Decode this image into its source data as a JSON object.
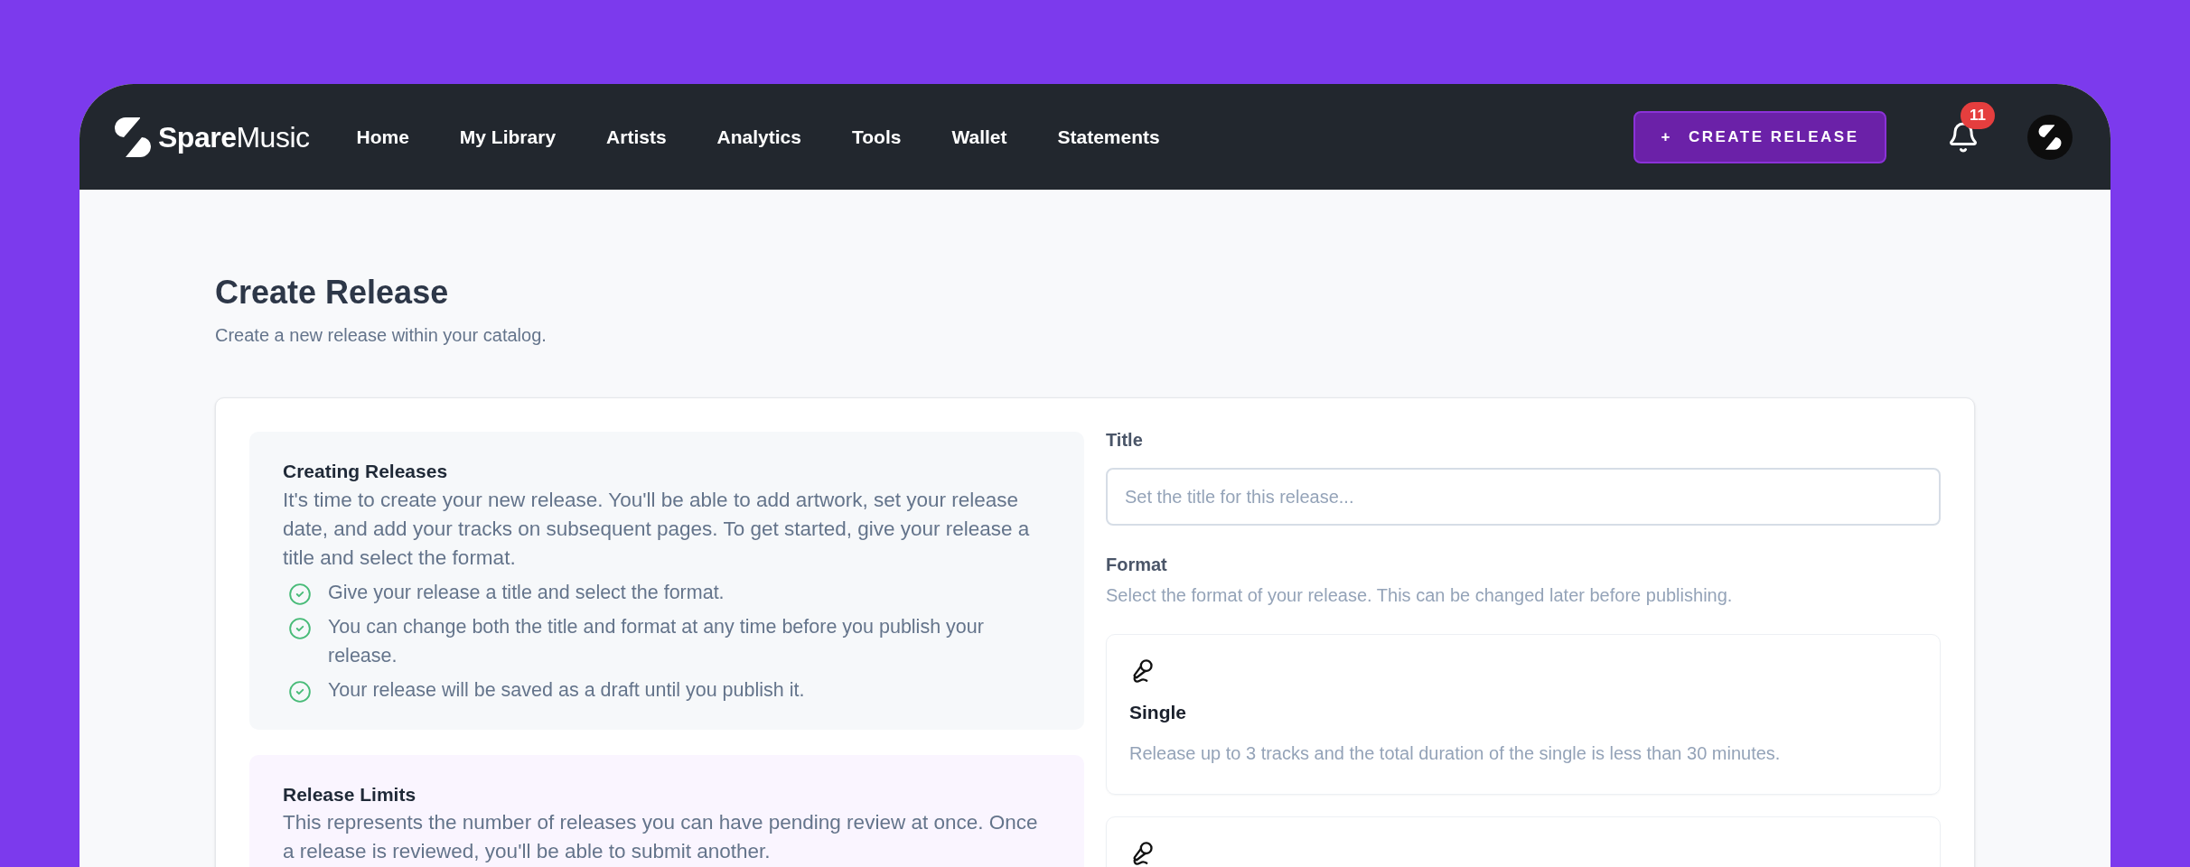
{
  "header": {
    "logo": "**Spare**Music",
    "nav": [
      {
        "label": "Home"
      },
      {
        "label": "My Library"
      },
      {
        "label": "Artists"
      },
      {
        "label": "Analytics"
      },
      {
        "label": "Tools"
      },
      {
        "label": "Wallet"
      },
      {
        "label": "Statements"
      }
    ],
    "create_button": {
      "icon": "+",
      "label": "CREATE RELEASE"
    },
    "notifications": {
      "count": "11"
    }
  },
  "page": {
    "title": "Create Release",
    "subtitle": "Create a new release within your catalog."
  },
  "info_panels": [
    {
      "color": "#f6f8fa",
      "title": "Creating Releases",
      "text": "It's time to create your new release. You'll be able to add artwork, set your release date, and add your tracks on subsequent pages. To get started, give your release a title and select the format.",
      "checklist": [
        "Give your release a title and select the format.",
        "You can change both the title and format at any time before you publish your release.",
        "Your release will be saved as a draft until you publish it."
      ]
    },
    {
      "color": "#faf5ff",
      "title": "Release Limits",
      "text": "This represents the number of releases you can have pending review at once. Once a release is reviewed, you'll be able to submit another."
    }
  ],
  "form": {
    "title_label": "Title",
    "title_placeholder": "Set the title for this release...",
    "format_label": "Format",
    "format_hint": "Select the format of your release. This can be changed later before publishing.",
    "formats": [
      {
        "title": "Single",
        "description": "Release up to 3 tracks and the total duration of the single is less than 30 minutes."
      }
    ],
    "more_formats_below": true
  }
}
